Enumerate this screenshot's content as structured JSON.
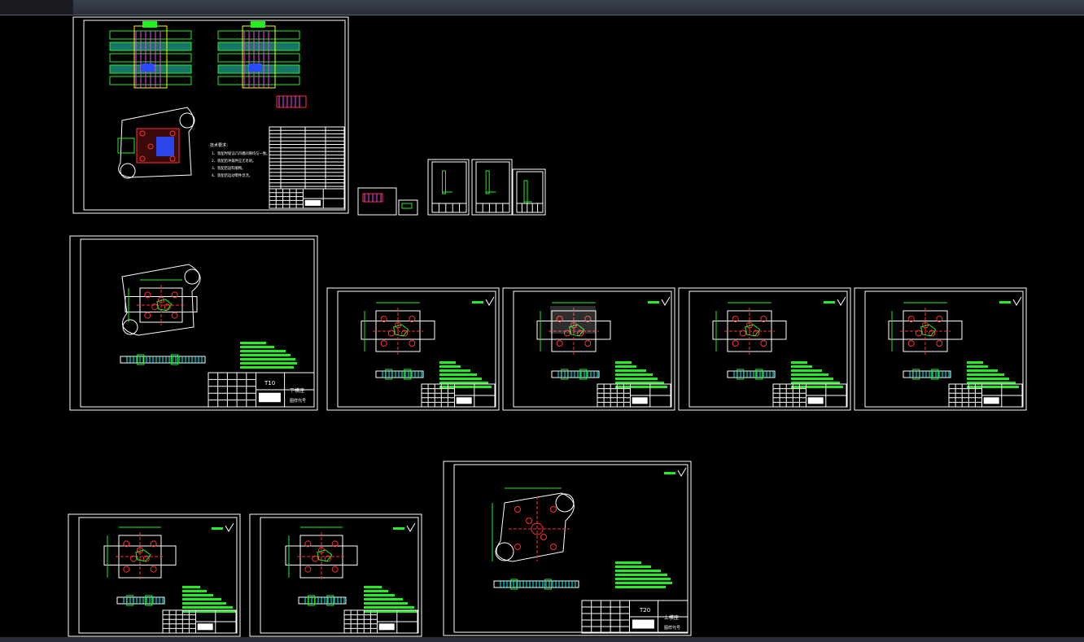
{
  "viewport": {
    "name": "cad-model-space",
    "background": "#000000"
  },
  "colors": {
    "frame": "#ffffff",
    "layer_green": "#22ee22",
    "layer_red": "#ff3030",
    "layer_cyan": "#00ffff",
    "layer_magenta": "#ff40ff",
    "layer_blue": "#2a4cff",
    "layer_yellow": "#ffff00",
    "hatch_teal": "#1f9d8a"
  },
  "sheets": {
    "assembly": {
      "notes_heading": "技术要求：",
      "notes": [
        "1、装配时保证凸凹模间隙均匀一致。",
        "2、装配后冲裁件应无毛刺。",
        "3、装配后送料顺畅。",
        "4、装配后运动零件灵活。"
      ]
    },
    "lower_die_base": {
      "part_code": "T10",
      "part_name": "下模座",
      "sub_label": "图样代号"
    },
    "upper_die_base": {
      "part_code": "T20",
      "part_name": "上模座",
      "sub_label": "图样代号"
    }
  }
}
